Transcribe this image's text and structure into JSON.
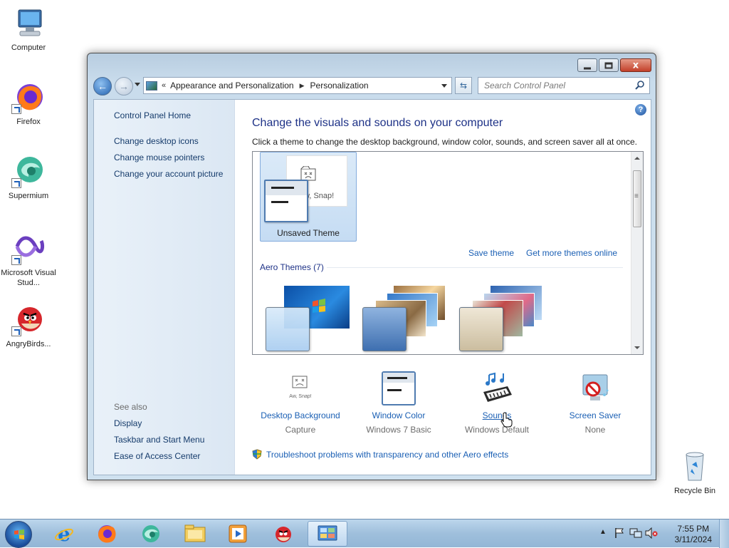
{
  "desktop": {
    "icons": [
      {
        "label": "Computer",
        "icon": "computer-icon"
      },
      {
        "label": "Firefox",
        "icon": "firefox-icon"
      },
      {
        "label": "Supermium",
        "icon": "supermium-icon"
      },
      {
        "label": "Microsoft Visual Stud...",
        "icon": "visual-studio-icon"
      },
      {
        "label": "AngryBirds...",
        "icon": "angry-birds-icon"
      },
      {
        "label": "Recycle Bin",
        "icon": "recycle-bin-icon"
      }
    ]
  },
  "window": {
    "title_buttons": {
      "minimize": "minimize",
      "maximize": "maximize",
      "close": "x"
    },
    "address": {
      "overflow": "«",
      "crumbs": [
        "Appearance and Personalization",
        "Personalization"
      ]
    },
    "search": {
      "placeholder": "Search Control Panel"
    },
    "left_pane": {
      "home": "Control Panel Home",
      "links": [
        "Change desktop icons",
        "Change mouse pointers",
        "Change your account picture"
      ],
      "see_also_label": "See also",
      "see_also": [
        "Display",
        "Taskbar and Start Menu",
        "Ease of Access Center"
      ]
    },
    "main": {
      "heading": "Change the visuals and sounds on your computer",
      "subtext": "Click a theme to change the desktop background, window color, sounds, and screen saver all at once.",
      "unsaved_theme": {
        "label": "Unsaved Theme",
        "preview_text": "w, Snap!"
      },
      "save_theme": "Save theme",
      "get_more": "Get more themes online",
      "aero_label": "Aero Themes (7)",
      "settings": [
        {
          "name": "Desktop Background",
          "value": "Capture",
          "icon": "desktop-background-icon"
        },
        {
          "name": "Window Color",
          "value": "Windows 7 Basic",
          "icon": "window-color-icon"
        },
        {
          "name": "Sounds",
          "value": "Windows Default",
          "icon": "sounds-icon"
        },
        {
          "name": "Screen Saver",
          "value": "None",
          "icon": "screen-saver-icon"
        }
      ],
      "troubleshoot": "Troubleshoot problems with transparency and other Aero effects",
      "sound_icon_text": "Aw, Snap!"
    }
  },
  "taskbar": {
    "clock_time": "7:55 PM",
    "clock_date": "3/11/2024",
    "items": [
      "internet-explorer-icon",
      "firefox-icon",
      "supermium-icon",
      "file-explorer-icon",
      "media-player-icon",
      "angry-birds-icon",
      "control-panel-icon"
    ]
  },
  "colors": {
    "link": "#1a5fb4",
    "heading": "#1e3287",
    "taskbar": "#9fbfdc"
  }
}
